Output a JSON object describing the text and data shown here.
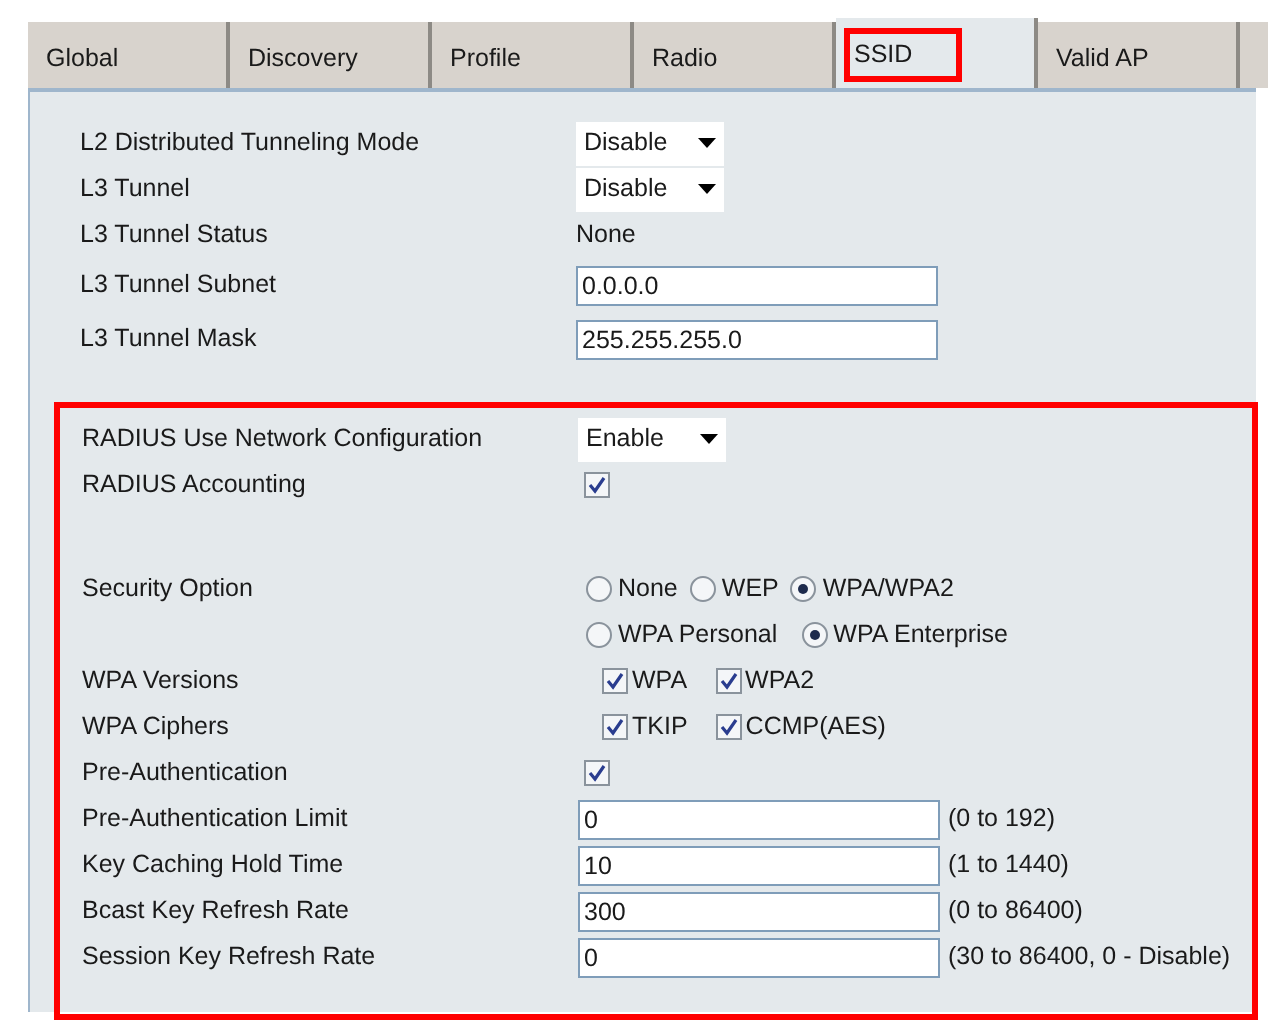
{
  "tabs": [
    {
      "label": "Global",
      "selected": false,
      "highlighted": false
    },
    {
      "label": "Discovery",
      "selected": false,
      "highlighted": false
    },
    {
      "label": "Profile",
      "selected": false,
      "highlighted": false
    },
    {
      "label": "Radio",
      "selected": false,
      "highlighted": false
    },
    {
      "label": "SSID",
      "selected": true,
      "highlighted": true
    },
    {
      "label": "Valid AP",
      "selected": false,
      "highlighted": false
    }
  ],
  "tunnel_rows": [
    {
      "kind": "select",
      "label": "L2 Distributed Tunneling Mode",
      "value": "Disable"
    },
    {
      "kind": "select",
      "label": "L3 Tunnel",
      "value": "Disable"
    },
    {
      "kind": "text",
      "label": "L3 Tunnel Status",
      "value": "None"
    },
    {
      "kind": "input",
      "label": "L3 Tunnel Subnet",
      "value": "0.0.0.0"
    },
    {
      "kind": "input",
      "label": "L3 Tunnel Mask",
      "value": "255.255.255.0"
    }
  ],
  "security_section": {
    "highlighted": true,
    "rows": [
      {
        "kind": "select",
        "label": "RADIUS Use Network Configuration",
        "value": "Enable"
      },
      {
        "kind": "checkbox",
        "label": "RADIUS Accounting",
        "checked": true
      },
      {
        "kind": "spacer"
      },
      {
        "kind": "radio",
        "label": "Security Option",
        "options": [
          {
            "label": "None",
            "selected": false
          },
          {
            "label": "WEP",
            "selected": false
          },
          {
            "label": "WPA/WPA2",
            "selected": true
          }
        ]
      },
      {
        "kind": "radio",
        "options": [
          {
            "label": "WPA Personal",
            "selected": false
          },
          {
            "label": "WPA Enterprise",
            "selected": true
          }
        ]
      },
      {
        "kind": "checks",
        "label": "WPA Versions",
        "options": [
          {
            "label": "WPA",
            "checked": true
          },
          {
            "label": "WPA2",
            "checked": true
          }
        ]
      },
      {
        "kind": "checks",
        "label": "WPA Ciphers",
        "options": [
          {
            "label": "TKIP",
            "checked": true
          },
          {
            "label": "CCMP(AES)",
            "checked": true
          }
        ]
      },
      {
        "kind": "checkbox",
        "label": "Pre-Authentication",
        "checked": true
      },
      {
        "kind": "input",
        "label": "Pre-Authentication Limit",
        "value": "0",
        "hint": "(0 to 192)"
      },
      {
        "kind": "input",
        "label": "Key Caching Hold Time",
        "value": "10",
        "hint": "(1 to 1440)"
      },
      {
        "kind": "input",
        "label": "Bcast Key Refresh Rate",
        "value": "300",
        "hint": "(0 to 86400)"
      },
      {
        "kind": "input",
        "label": "Session Key Refresh Rate",
        "value": "0",
        "hint": "(30 to 86400, 0 - Disable)"
      }
    ]
  }
}
